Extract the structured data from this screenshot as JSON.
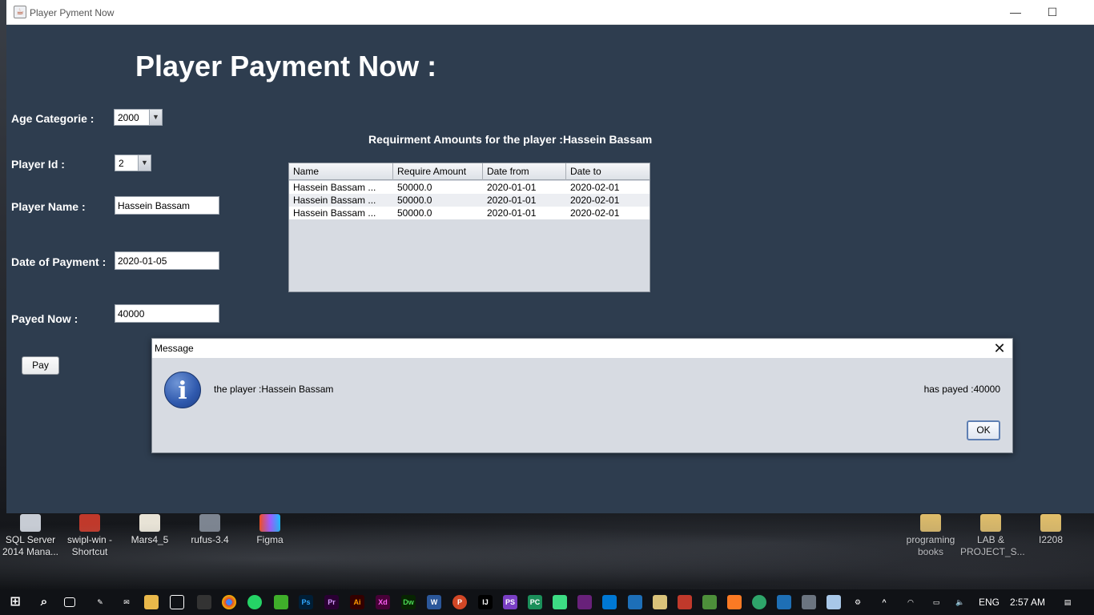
{
  "window": {
    "title": "Player Pyment Now"
  },
  "form": {
    "heading": "Player Payment Now :",
    "age_label": "Age Categorie :",
    "age_value": "2000",
    "player_id_label": "Player Id :",
    "player_id_value": "2",
    "player_name_label": "Player Name :",
    "player_name_value": "Hassein Bassam",
    "date_label": "Date of Payment :",
    "date_value": "2020-01-05",
    "payed_label": "Payed Now :",
    "payed_value": "40000",
    "pay_button": "Pay"
  },
  "table": {
    "title": "Requirment Amounts for the player :Hassein Bassam",
    "columns": [
      "Name",
      "Require Amount",
      "Date from",
      "Date to"
    ],
    "rows": [
      [
        "Hassein Bassam ...",
        "50000.0",
        "2020-01-01",
        "2020-02-01"
      ],
      [
        "Hassein Bassam ...",
        "50000.0",
        "2020-01-01",
        "2020-02-01"
      ],
      [
        "Hassein Bassam ...",
        "50000.0",
        "2020-01-01",
        "2020-02-01"
      ]
    ]
  },
  "dialog": {
    "title": "Message",
    "message_left": "the player :Hassein Bassam",
    "message_right": "has payed :40000",
    "ok_button": "OK",
    "icon": "info-icon"
  },
  "desktop": {
    "icons": [
      {
        "label1": "SQL Server",
        "label2": "2014 Mana..."
      },
      {
        "label1": "swipl-win -",
        "label2": "Shortcut"
      },
      {
        "label1": "Mars4_5",
        "label2": ""
      },
      {
        "label1": "rufus-3.4",
        "label2": ""
      },
      {
        "label1": "Figma",
        "label2": ""
      },
      {
        "label1": "programing",
        "label2": "books"
      },
      {
        "label1": "LAB &",
        "label2": "PROJECT_S..."
      },
      {
        "label1": "I2208",
        "label2": ""
      }
    ]
  },
  "taskbar": {
    "language": "ENG",
    "time": "2:57 AM",
    "apps": [
      "Ps",
      "Pr",
      "Ai",
      "Xd",
      "Dw",
      "W",
      "P",
      "IJ",
      "PS",
      "PC"
    ]
  }
}
